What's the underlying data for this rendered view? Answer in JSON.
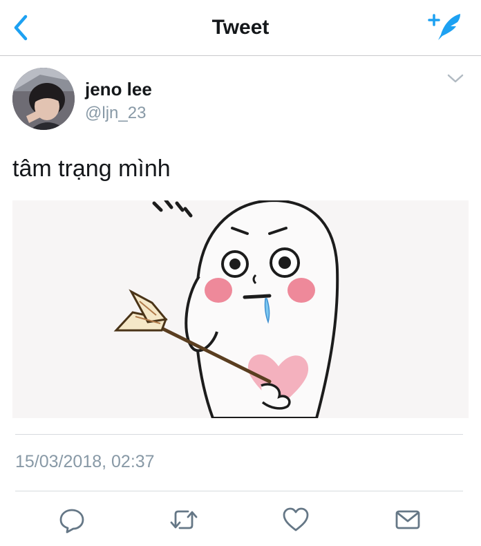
{
  "nav": {
    "title": "Tweet",
    "back_icon": "chevron-left-icon",
    "compose_icon": "compose-tweet-icon",
    "accent_color": "#1da1f2"
  },
  "tweet": {
    "author_name": "jeno lee",
    "author_handle": "@ljn_23",
    "text": "tâm trạng mình",
    "timestamp": "15/03/2018, 02:37",
    "media_alt": "cartoon character with an arrow pierced through a pink heart"
  },
  "actions": [
    {
      "icon": "reply-icon"
    },
    {
      "icon": "retweet-icon"
    },
    {
      "icon": "like-icon"
    },
    {
      "icon": "direct-message-icon"
    }
  ]
}
